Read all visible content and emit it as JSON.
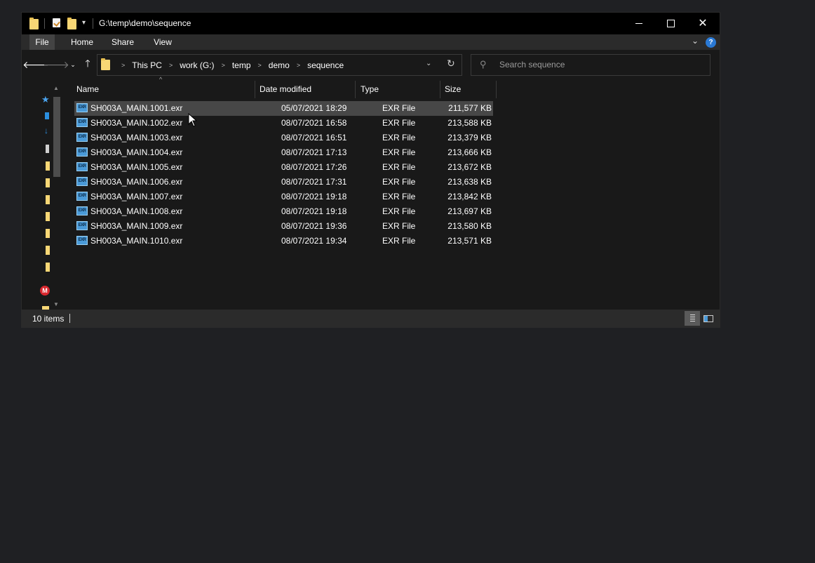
{
  "window": {
    "title": "G:\\temp\\demo\\sequence",
    "controls": {
      "minimize": "minimize",
      "maximize": "maximize",
      "close": "close"
    }
  },
  "ribbon": {
    "tabs": [
      "File",
      "Home",
      "Share",
      "View"
    ],
    "active_tab": "File"
  },
  "address": {
    "breadcrumbs": [
      "This PC",
      "work (G:)",
      "temp",
      "demo",
      "sequence"
    ]
  },
  "search": {
    "placeholder": "Search sequence"
  },
  "columns": {
    "name": "Name",
    "date": "Date modified",
    "type": "Type",
    "size": "Size"
  },
  "files": [
    {
      "name": "SH003A_MAIN.1001.exr",
      "date": "05/07/2021 18:29",
      "type": "EXR File",
      "size": "211,577 KB",
      "selected": true
    },
    {
      "name": "SH003A_MAIN.1002.exr",
      "date": "08/07/2021 16:58",
      "type": "EXR File",
      "size": "213,588 KB"
    },
    {
      "name": "SH003A_MAIN.1003.exr",
      "date": "08/07/2021 16:51",
      "type": "EXR File",
      "size": "213,379 KB"
    },
    {
      "name": "SH003A_MAIN.1004.exr",
      "date": "08/07/2021 17:13",
      "type": "EXR File",
      "size": "213,666 KB"
    },
    {
      "name": "SH003A_MAIN.1005.exr",
      "date": "08/07/2021 17:26",
      "type": "EXR File",
      "size": "213,672 KB"
    },
    {
      "name": "SH003A_MAIN.1006.exr",
      "date": "08/07/2021 17:31",
      "type": "EXR File",
      "size": "213,638 KB"
    },
    {
      "name": "SH003A_MAIN.1007.exr",
      "date": "08/07/2021 19:18",
      "type": "EXR File",
      "size": "213,842 KB"
    },
    {
      "name": "SH003A_MAIN.1008.exr",
      "date": "08/07/2021 19:18",
      "type": "EXR File",
      "size": "213,697 KB"
    },
    {
      "name": "SH003A_MAIN.1009.exr",
      "date": "08/07/2021 19:36",
      "type": "EXR File",
      "size": "213,580 KB"
    },
    {
      "name": "SH003A_MAIN.1010.exr",
      "date": "08/07/2021 19:34",
      "type": "EXR File",
      "size": "213,571 KB"
    }
  ],
  "status": {
    "item_count": "10 items"
  },
  "colors": {
    "selected_row": "#474747",
    "help_icon": "#2a79d4",
    "folder": "#f8d775",
    "mega": "#d9272e"
  }
}
